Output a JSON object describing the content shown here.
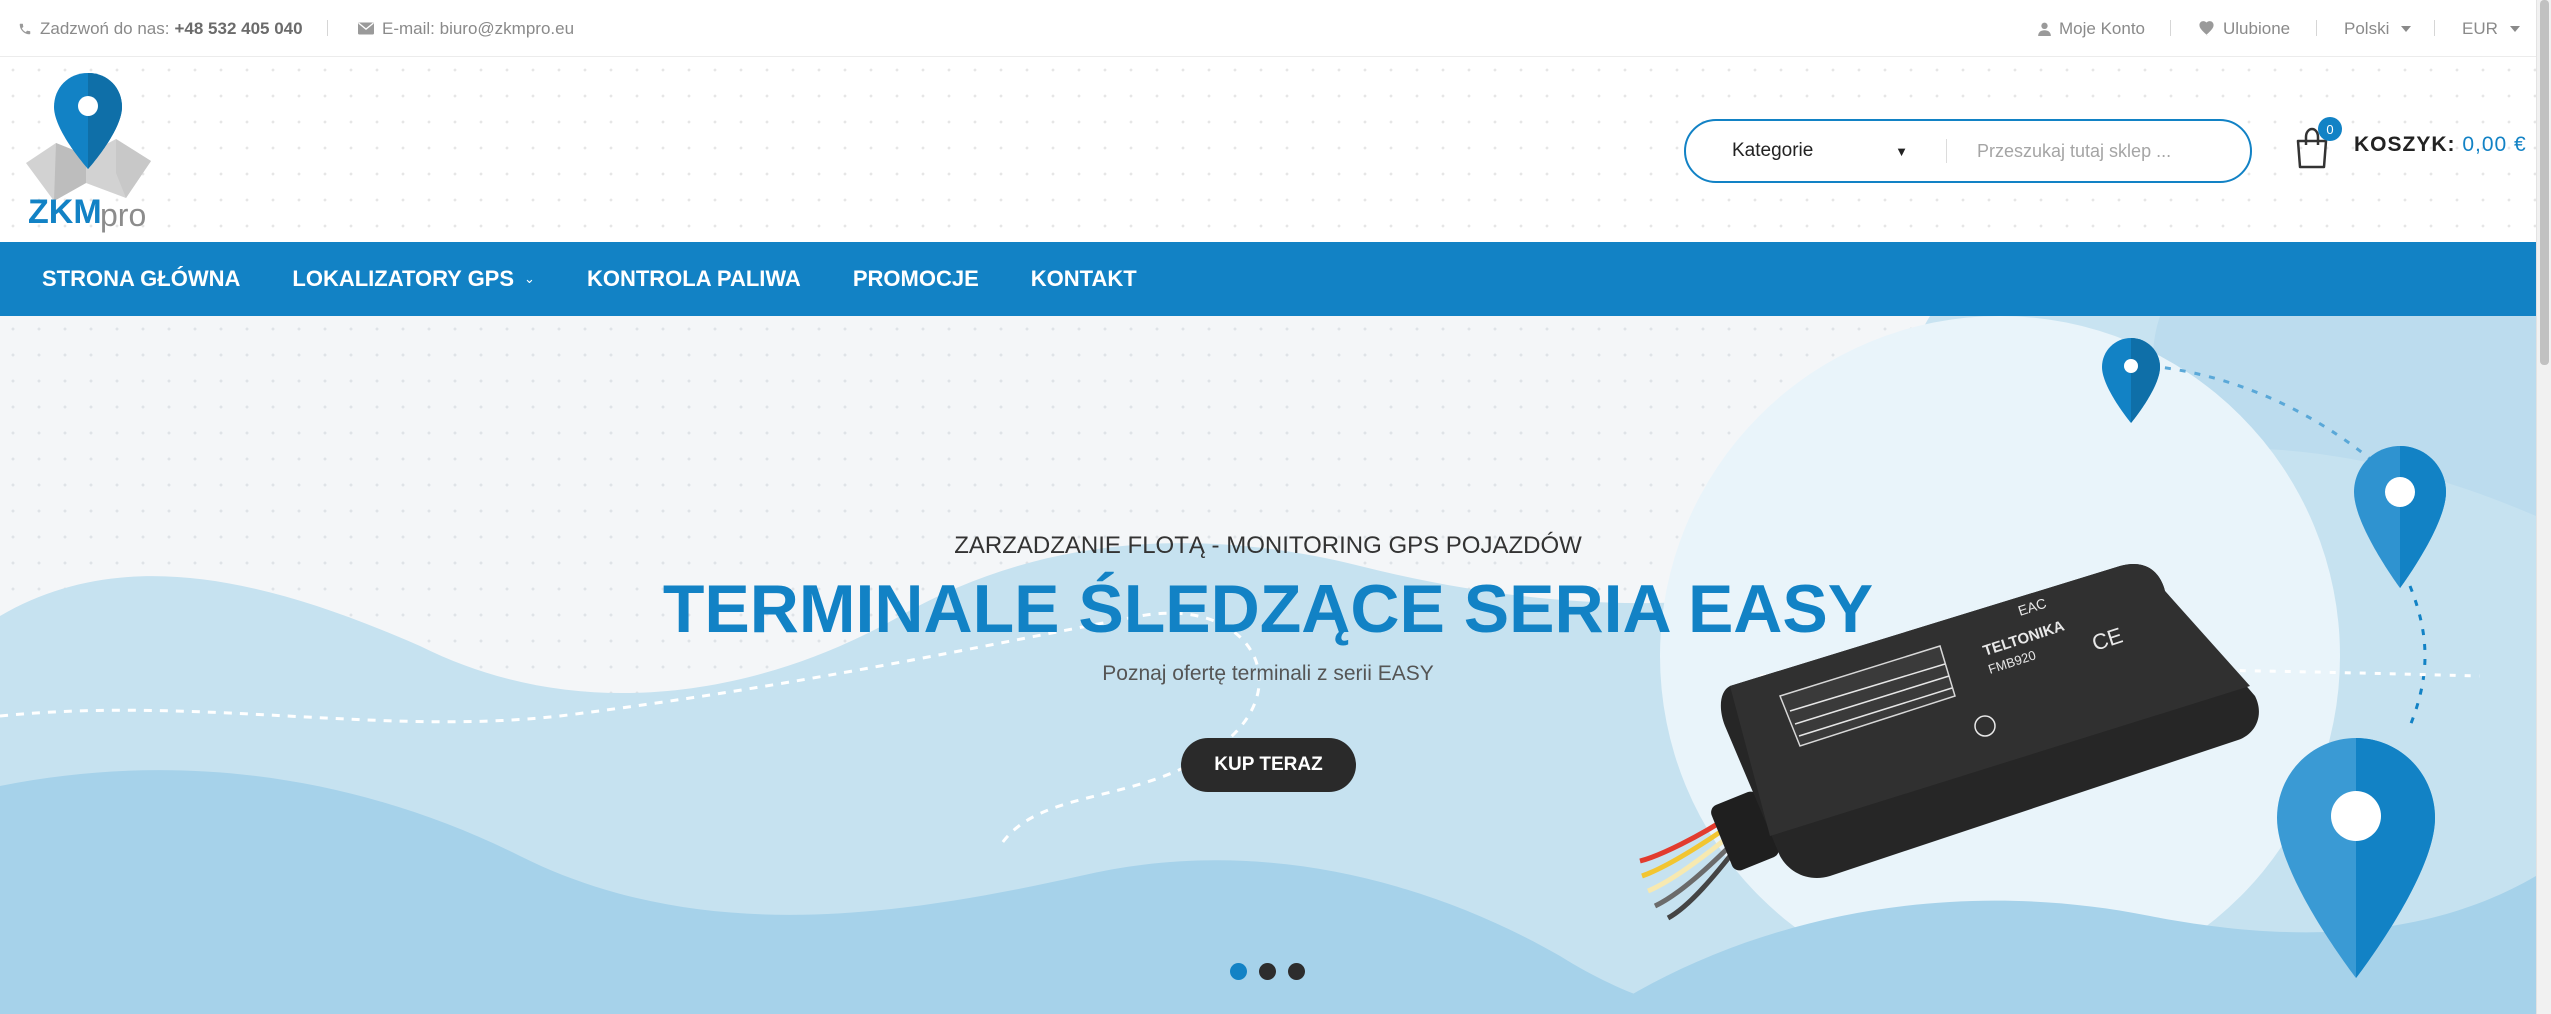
{
  "topbar": {
    "phone_label": "Zadzwoń do nas:",
    "phone_number": "+48 532 405 040",
    "email": "E-mail: biuro@zkmpro.eu",
    "account": "Moje Konto",
    "wishlist": "Ulubione",
    "language": "Polski",
    "currency": "EUR"
  },
  "header": {
    "logo_text": "ZKMpro",
    "search": {
      "category_label": "Kategorie",
      "placeholder": "Przeszukaj tutaj sklep ..."
    },
    "cart": {
      "count": "0",
      "label": "KOSZYK:",
      "amount": "0,00 €"
    }
  },
  "nav": {
    "items": [
      {
        "label": "STRONA GŁÓWNA"
      },
      {
        "label": "LOKALIZATORY GPS"
      },
      {
        "label": "KONTROLA PALIWA"
      },
      {
        "label": "PROMOCJE"
      },
      {
        "label": "KONTAKT"
      }
    ]
  },
  "hero": {
    "subtitle": "ZARZADZANIE FLOTĄ - MONITORING GPS POJAZDÓW",
    "title": "TERMINALE ŚLEDZĄCE SERIA EASY",
    "description": "Poznaj ofertę terminali z serii EASY",
    "cta": "KUP TERAZ",
    "slides": 3,
    "active_slide": 1,
    "device_brand": "TELTONIKA",
    "device_model": "FMB920"
  },
  "colors": {
    "primary": "#1282c5",
    "dark": "#2a2a2a",
    "wave_light": "#c6e2f0",
    "wave_mid": "#a6d2ea"
  }
}
